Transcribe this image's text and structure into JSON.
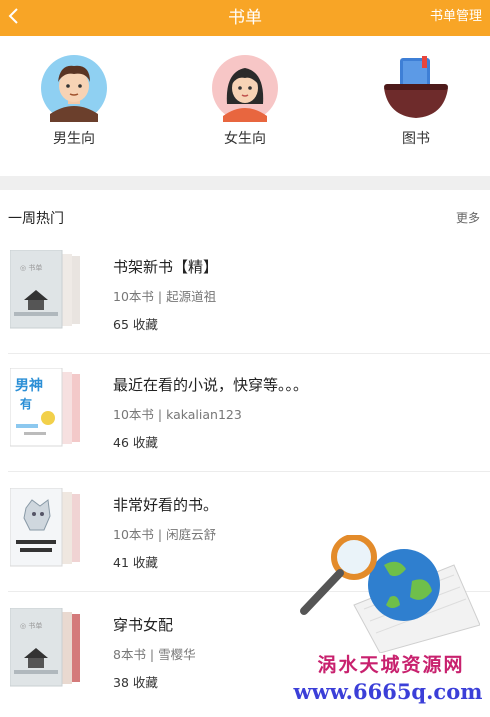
{
  "header": {
    "title": "书单",
    "manage_label": "书单管理",
    "bar_color": "#f8a526"
  },
  "categories": [
    {
      "label": "男生向",
      "icon": "boy-avatar-icon"
    },
    {
      "label": "女生向",
      "icon": "girl-avatar-icon"
    },
    {
      "label": "图书",
      "icon": "book-bowl-icon"
    }
  ],
  "section": {
    "title": "一周热门",
    "more_label": "更多"
  },
  "lists": [
    {
      "title": "书架新书【精】",
      "meta": "10本书 | 起源道祖",
      "favorites": "65 收藏"
    },
    {
      "title": "最近在看的小说，快穿等。。。",
      "meta": "10本书 | kakalian123",
      "favorites": "46 收藏"
    },
    {
      "title": "非常好看的书。",
      "meta": "10本书 | 闲庭云舒",
      "favorites": "41 收藏"
    },
    {
      "title": "穿书女配",
      "meta": "8本书 | 雪樱华",
      "favorites": "38 收藏"
    }
  ],
  "watermark": {
    "line1": "涡水天城资源网",
    "line2": "www.6665q.com"
  }
}
